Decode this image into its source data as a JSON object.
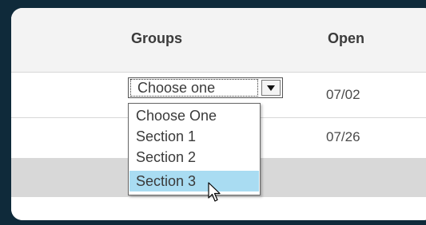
{
  "table": {
    "headers": {
      "groups": "Groups",
      "open": "Open"
    },
    "rows": [
      {
        "open": "07/02"
      },
      {
        "open": "07/26"
      }
    ]
  },
  "groups_select": {
    "selected": "Choose one",
    "options": [
      "Choose One",
      "Section 1",
      "Section 2",
      "Section 3"
    ],
    "highlighted_index": 3,
    "expanded": true
  },
  "icons": {
    "dropdown_arrow": "caret-down-icon",
    "cursor": "mouse-pointer-icon"
  },
  "colors": {
    "background": "#0f2a3a",
    "highlight": "#a9dcf2"
  }
}
